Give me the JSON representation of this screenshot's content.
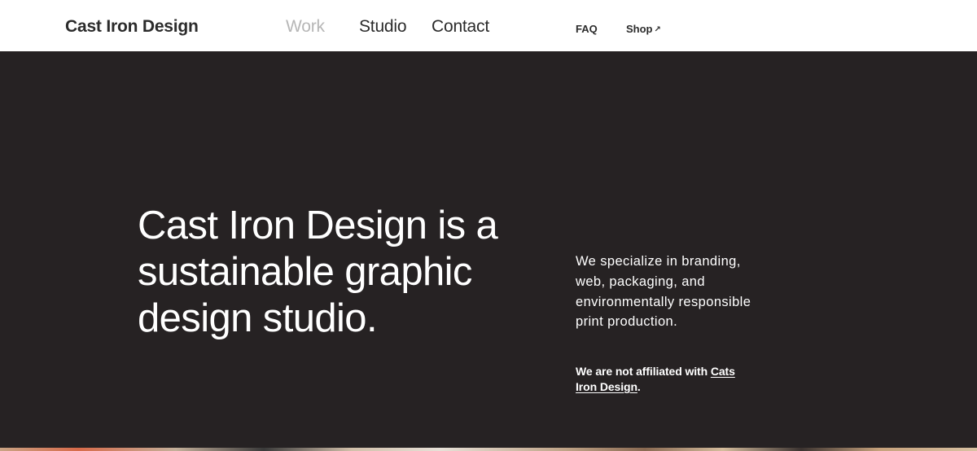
{
  "header": {
    "logo": "Cast Iron Design",
    "nav_main": [
      "Work",
      "Studio",
      "Contact"
    ],
    "nav_util": {
      "faq": "FAQ",
      "shop": "Shop",
      "shop_arrow": "↗"
    }
  },
  "hero": {
    "headline": "Cast Iron Design is a sustainable graphic design studio.",
    "intro": "We specialize in branding, web, packaging, and environmentally responsible print production.",
    "note_prefix": "We are not affiliated with ",
    "note_link": "Cats Iron Design",
    "note_suffix": "."
  },
  "colors": {
    "hero_background": "#262223",
    "active_nav": "#b6b6b6",
    "text_dark": "#2b2b2b",
    "text_light": "#ffffff"
  }
}
